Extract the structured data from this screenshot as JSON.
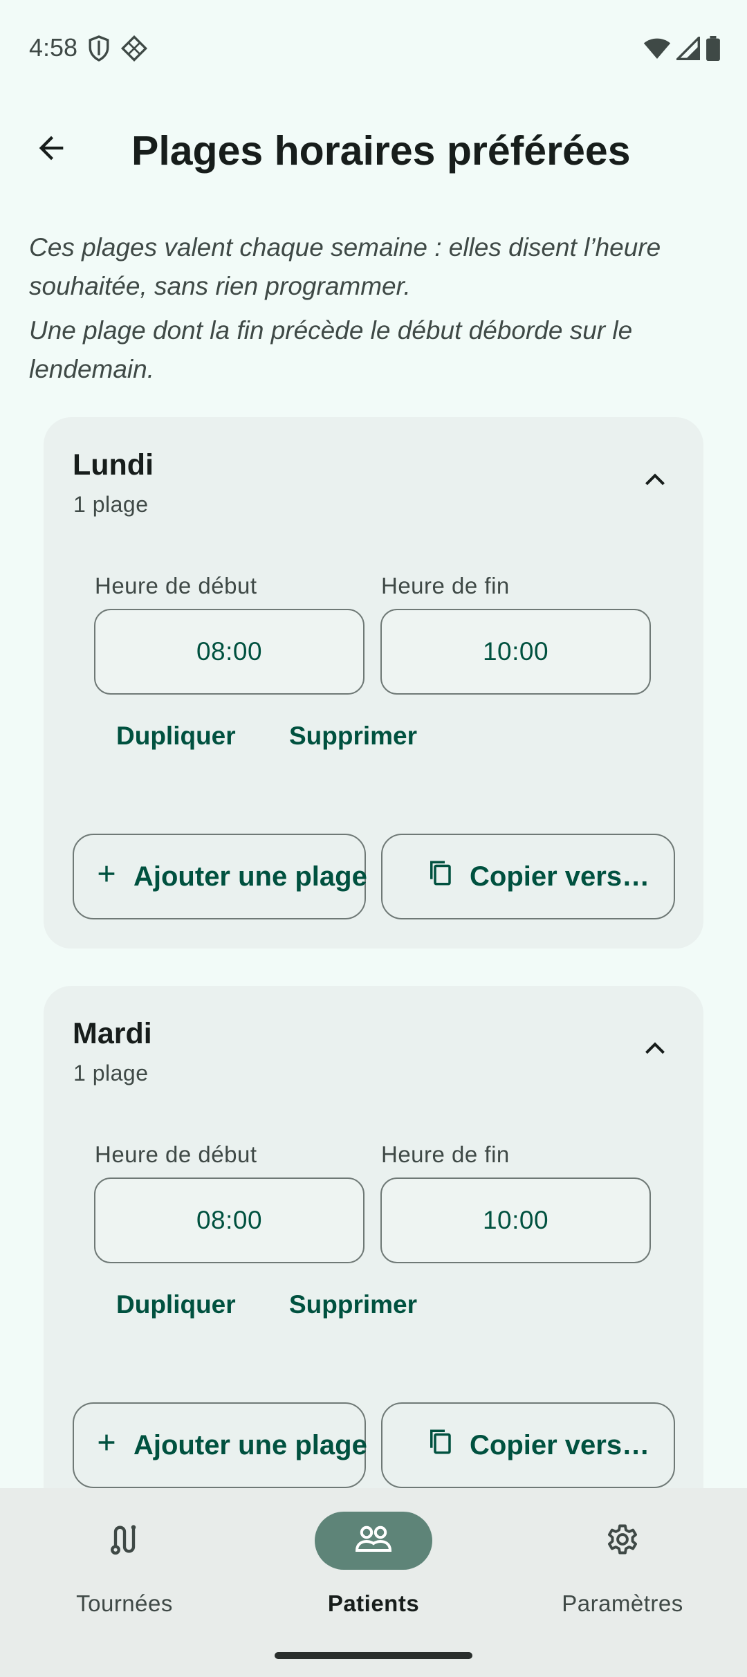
{
  "status": {
    "time": "4:58",
    "left_icons": [
      "shield-icon",
      "diamond-grid-icon"
    ],
    "right_icons": [
      "wifi-icon",
      "signal-icon",
      "battery-icon"
    ]
  },
  "top_bar": {
    "back_icon": "arrow-back-icon",
    "title": "Plages horaires préférées"
  },
  "intro": {
    "line1": "Ces plages valent chaque semaine : elles disent l’heure souhaitée, sans rien programmer.",
    "line2": "Une plage dont la fin précède le début déborde sur le lendemain."
  },
  "days": [
    {
      "name": "Lundi",
      "count": "1 plage",
      "expanded": true,
      "start_label": "Heure de début",
      "end_label": "Heure de fin",
      "start": "08:00",
      "end": "10:00",
      "duplicate": "Dupliquer",
      "delete": "Supprimer",
      "add": "Ajouter une plage",
      "copy": "Copier vers…"
    },
    {
      "name": "Mardi",
      "count": "1 plage",
      "expanded": true,
      "start_label": "Heure de début",
      "end_label": "Heure de fin",
      "start": "08:00",
      "end": "10:00",
      "duplicate": "Dupliquer",
      "delete": "Supprimer",
      "add": "Ajouter une plage",
      "copy": "Copier vers…"
    }
  ],
  "nav": {
    "items": [
      {
        "label": "Tournées",
        "icon": "route-icon",
        "active": false
      },
      {
        "label": "Patients",
        "icon": "people-icon",
        "active": true
      },
      {
        "label": "Paramètres",
        "icon": "gear-icon",
        "active": false
      }
    ]
  },
  "colors": {
    "background": "#F2FBF8",
    "card": "#EAF1EF",
    "accent": "#00513F",
    "nav_active_pill": "#5E8478",
    "nav_bar": "#E8ECEA"
  }
}
